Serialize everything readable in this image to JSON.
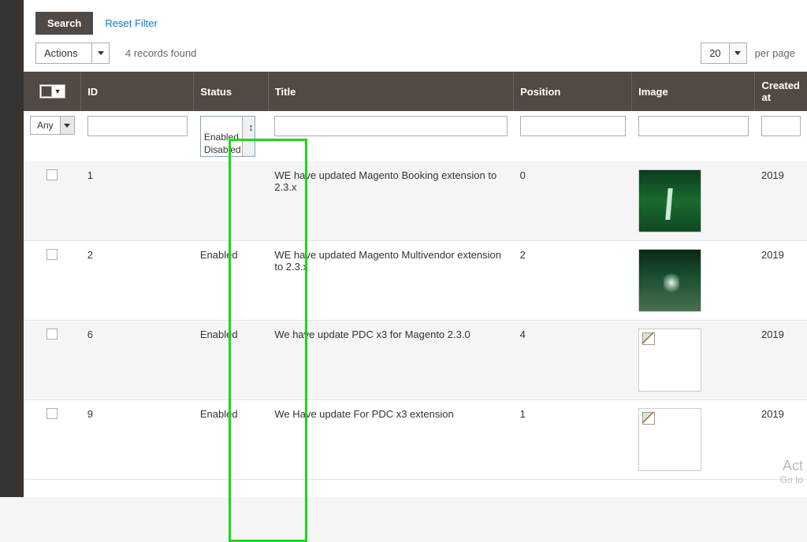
{
  "toolbar": {
    "search_label": "Search",
    "reset_label": "Reset Filter"
  },
  "secondbar": {
    "actions_label": "Actions",
    "records_found": "4 records found",
    "page_size": "20",
    "per_page": "per page"
  },
  "columns": {
    "id": "ID",
    "status": "Status",
    "title": "Title",
    "position": "Position",
    "image": "Image",
    "created": "Created at"
  },
  "filters": {
    "any_label": "Any",
    "status_options": [
      "Enabled",
      "Disabled"
    ]
  },
  "rows": [
    {
      "id": "1",
      "status": "",
      "title": "WE have updated Magento Booking extension to 2.3.x",
      "position": "0",
      "created": "2019",
      "thumb": "green1"
    },
    {
      "id": "2",
      "status": "Enabled",
      "title": "WE have updated Magento Multivendor extension to 2.3.x",
      "position": "2",
      "created": "2019",
      "thumb": "green2"
    },
    {
      "id": "6",
      "status": "Enabled",
      "title": "We have update PDC x3 for Magento 2.3.0",
      "position": "4",
      "created": "2019",
      "thumb": "broken"
    },
    {
      "id": "9",
      "status": "Enabled",
      "title": "We Have update For PDC x3 extension",
      "position": "1",
      "created": "2019",
      "thumb": "broken"
    }
  ],
  "activate": {
    "line1": "Act",
    "line2": "Go to"
  }
}
